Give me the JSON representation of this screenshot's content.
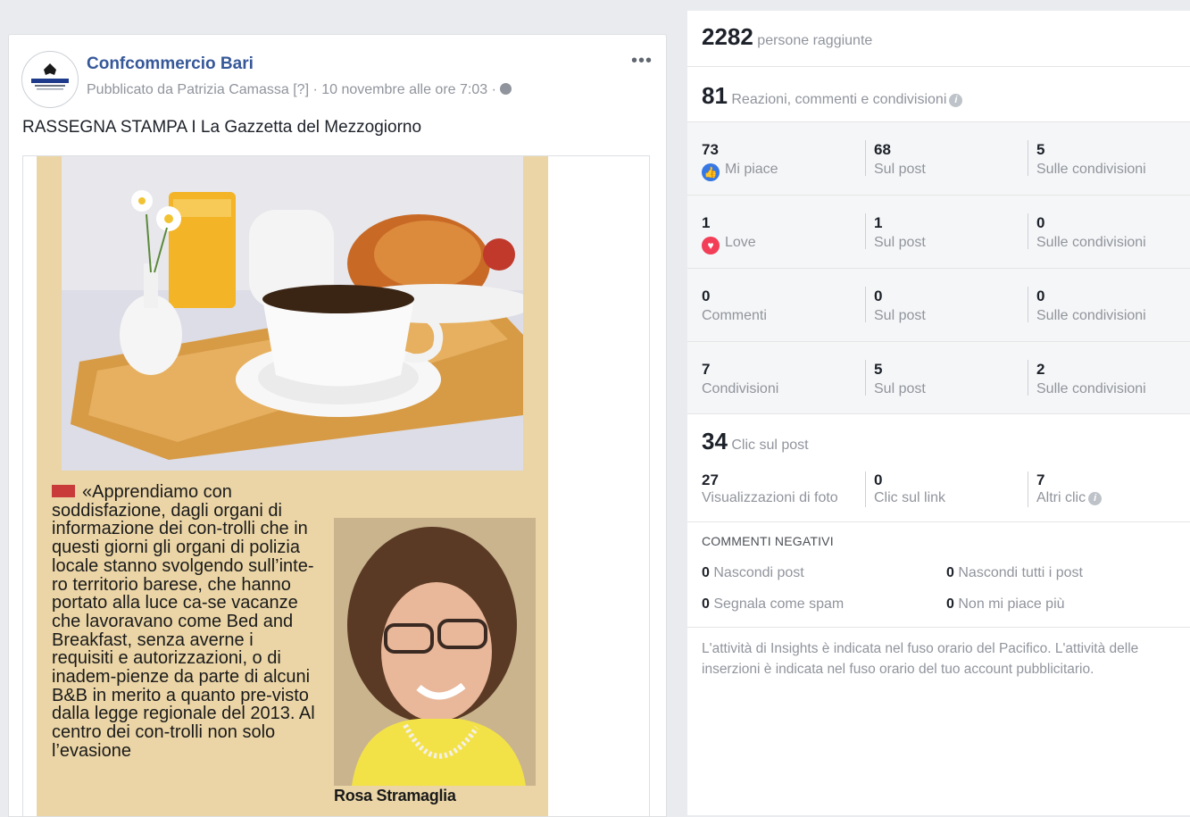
{
  "post": {
    "page_name": "Confcommercio Bari",
    "byline": "Pubblicato da Patrizia Camassa [?] · 10 novembre alle ore 7:03 ·",
    "more": "•••",
    "text": "RASSEGNA STAMPA I La Gazzetta del Mezzogiorno",
    "avatar_text": "CONFCOMMERCIO",
    "clipping": {
      "quote": "«Apprendiamo con soddisfazione, dagli organi di informazione dei con-trolli che in questi giorni gli organi di polizia locale stanno svolgendo sull’inte-ro territorio barese, che hanno portato alla luce ca-se vacanze che lavoravano come Bed and Breakfast, senza averne i requisiti e autorizzazioni, o di inadem-pienze da parte di alcuni B&B in merito a quanto pre-visto dalla legge regionale del 2013. Al centro dei con-trolli non solo l’evasione",
      "caption": "Rosa Stramaglia"
    }
  },
  "insights": {
    "reach": {
      "value": "2282",
      "label": "persone raggiunte"
    },
    "engagement": {
      "value": "81",
      "label": "Reazioni, commenti e condivisioni"
    },
    "breakdown": [
      {
        "total": "73",
        "label": "Mi piace",
        "icon": "like-icon",
        "on_post": "68",
        "on_post_label": "Sul post",
        "on_shares": "5",
        "on_shares_label": "Sulle condivisioni"
      },
      {
        "total": "1",
        "label": "Love",
        "icon": "love-icon",
        "on_post": "1",
        "on_post_label": "Sul post",
        "on_shares": "0",
        "on_shares_label": "Sulle condivisioni"
      },
      {
        "total": "0",
        "label": "Commenti",
        "icon": "",
        "on_post": "0",
        "on_post_label": "Sul post",
        "on_shares": "0",
        "on_shares_label": "Sulle condivisioni"
      },
      {
        "total": "7",
        "label": "Condivisioni",
        "icon": "",
        "on_post": "5",
        "on_post_label": "Sul post",
        "on_shares": "2",
        "on_shares_label": "Sulle condivisioni"
      }
    ],
    "clicks": {
      "value": "34",
      "label": "Clic sul post",
      "photo_views": "27",
      "photo_views_label": "Visualizzazioni di foto",
      "link_clicks": "0",
      "link_clicks_label": "Clic sul link",
      "other_clicks": "7",
      "other_clicks_label": "Altri clic"
    },
    "negative": {
      "title": "COMMENTI NEGATIVI",
      "hide_post": "0",
      "hide_post_label": "Nascondi post",
      "hide_all": "0",
      "hide_all_label": "Nascondi tutti i post",
      "spam": "0",
      "spam_label": "Segnala come spam",
      "unlike": "0",
      "unlike_label": "Non mi piace più"
    },
    "footnote": "L'attività di Insights è indicata nel fuso orario del Pacifico. L'attività delle inserzioni è indicata nel fuso orario del tuo account pubblicitario."
  },
  "colors": {
    "link": "#365899",
    "like": "#3578e5",
    "love": "#f33e58",
    "clipping_bg": "#ebd5a6"
  }
}
